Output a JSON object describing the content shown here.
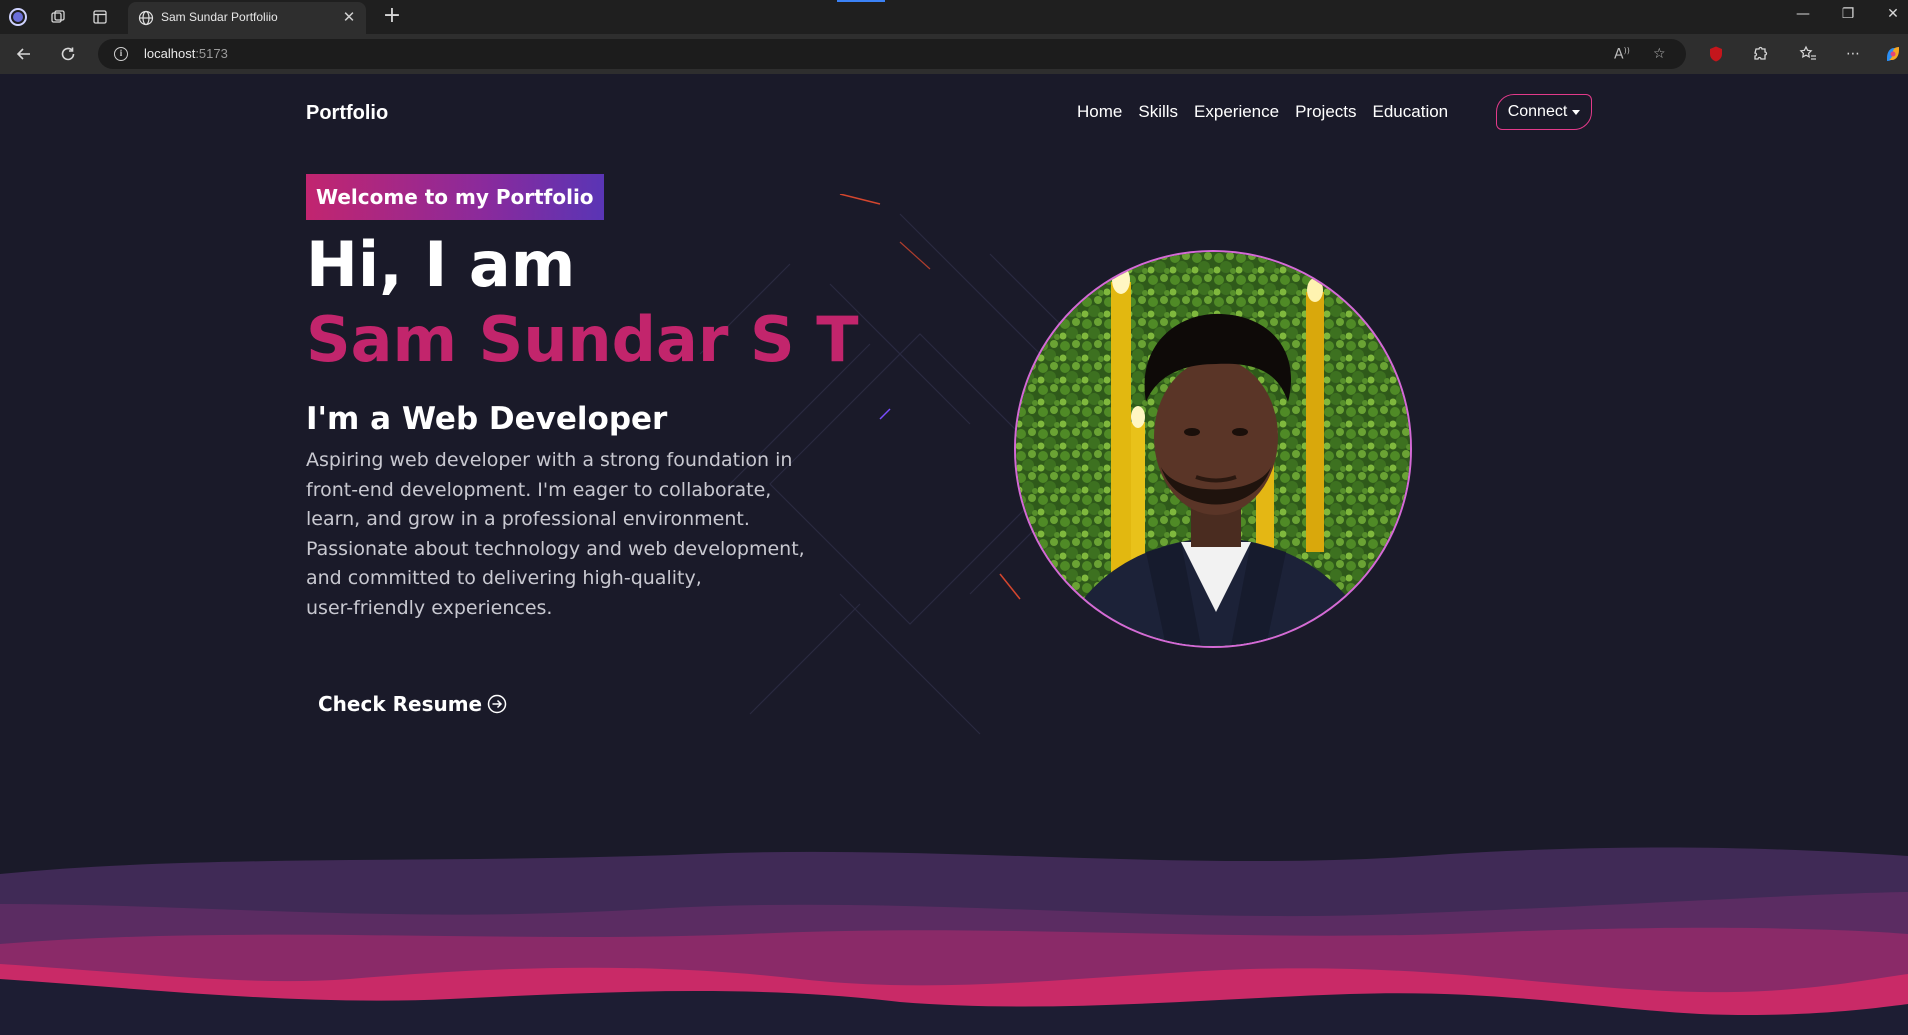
{
  "browser": {
    "tab_title": "Sam Sundar Portfoliio",
    "tab_close": "✕",
    "new_tab": "+",
    "url_host": "localhost",
    "url_port": ":5173",
    "window_controls": [
      "—",
      "❐",
      "✕"
    ]
  },
  "nav": {
    "brand": "Portfolio",
    "links": [
      "Home",
      "Skills",
      "Experience",
      "Projects",
      "Education"
    ],
    "connect": "Connect"
  },
  "hero": {
    "badge": "Welcome to my Portfolio",
    "greeting": "Hi, I am",
    "name": "Sam Sundar S T",
    "role": "I'm a Web Developer",
    "about_lines": [
      "Aspiring web developer with a strong foundation in",
      "front-end development. I'm eager to collaborate,",
      "learn, and grow in a professional environment.",
      "Passionate about technology and web development,",
      "and committed to delivering high-quality,",
      "user-friendly experiences."
    ],
    "resume": "Check Resume"
  },
  "colors": {
    "accent": "#c2256c",
    "avatar_border": "#d46ad6",
    "page_bg": "#1a1a29"
  },
  "icons": {
    "profile": "profile-circle-icon",
    "resume_arrow": "arrow-right-circle-icon",
    "info": "info-icon"
  }
}
